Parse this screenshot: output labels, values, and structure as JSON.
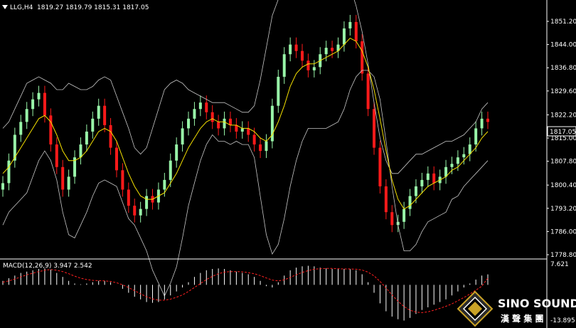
{
  "header": {
    "symbol": "LLG,H4",
    "ohlc": "1819.27 1819.79 1815.31 1817.05"
  },
  "price_axis": {
    "ticks": [
      "1851.20",
      "1844.00",
      "1836.80",
      "1829.60",
      "1822.20",
      "1815.00",
      "1807.80",
      "1800.40",
      "1793.20",
      "1786.00",
      "1778.80"
    ],
    "current_price": "1817.05"
  },
  "macd_panel": {
    "label": "MACD(12,26,9) 3.947 2.542",
    "top_label": "7.621",
    "bottom_label": "-13.895"
  },
  "logo": {
    "name": "SINO SOUND",
    "chinese": "漢 聲 集 團"
  },
  "colors": {
    "background": "#000000",
    "bull": "#98f5a8",
    "bear": "#ff1a1a",
    "ma": "#f5e100",
    "bands": "#c8c8c8",
    "macd_hist": "#ffffff",
    "macd_signal": "#ff2020"
  },
  "chart_data": [
    {
      "type": "line",
      "title": "LLG,H4",
      "description_series": [
        "close",
        "moving average",
        "bollinger upper",
        "bollinger lower"
      ],
      "ylim": [
        1778.8,
        1851.2
      ],
      "series": [
        {
          "name": "close",
          "values": [
            1801,
            1808,
            1816,
            1820,
            1824,
            1827,
            1829,
            1822,
            1813,
            1806,
            1799,
            1803,
            1809,
            1813,
            1817,
            1821,
            1825,
            1819,
            1812,
            1805,
            1799,
            1794,
            1791,
            1793,
            1797,
            1795,
            1799,
            1802,
            1808,
            1813,
            1818,
            1821,
            1824,
            1826,
            1823,
            1820,
            1818,
            1821,
            1819,
            1817,
            1818,
            1816,
            1813,
            1811,
            1814,
            1825,
            1834,
            1841,
            1844,
            1842,
            1839,
            1836,
            1837,
            1841,
            1843,
            1842,
            1844,
            1849,
            1851,
            1845,
            1835,
            1824,
            1812,
            1800,
            1792,
            1788,
            1789,
            1793,
            1797,
            1800,
            1802,
            1804,
            1801,
            1803,
            1806,
            1807,
            1809,
            1810,
            1813,
            1818,
            1821,
            1820
          ]
        },
        {
          "name": "moving average",
          "values": [
            1804,
            1806,
            1809,
            1812,
            1815,
            1818,
            1821,
            1822,
            1820,
            1816,
            1811,
            1808,
            1808,
            1809,
            1811,
            1814,
            1817,
            1818,
            1817,
            1814,
            1809,
            1804,
            1800,
            1797,
            1796,
            1796,
            1797,
            1798,
            1801,
            1804,
            1808,
            1812,
            1815,
            1818,
            1820,
            1821,
            1820,
            1820,
            1819,
            1819,
            1818,
            1818,
            1817,
            1815,
            1814,
            1816,
            1820,
            1825,
            1831,
            1835,
            1837,
            1838,
            1838,
            1839,
            1840,
            1841,
            1842,
            1844,
            1846,
            1845,
            1842,
            1837,
            1830,
            1821,
            1811,
            1802,
            1796,
            1793,
            1794,
            1796,
            1798,
            1800,
            1801,
            1802,
            1803,
            1805,
            1806,
            1808,
            1810,
            1812,
            1815,
            1817
          ]
        },
        {
          "name": "bollinger upper",
          "values": [
            1818,
            1820,
            1824,
            1828,
            1832,
            1833,
            1834,
            1833,
            1832,
            1830,
            1830,
            1832,
            1831,
            1830,
            1830,
            1831,
            1833,
            1834,
            1833,
            1828,
            1823,
            1818,
            1812,
            1810,
            1812,
            1818,
            1824,
            1830,
            1832,
            1833,
            1832,
            1830,
            1829,
            1828,
            1827,
            1826,
            1826,
            1826,
            1825,
            1824,
            1823,
            1823,
            1825,
            1833,
            1843,
            1853,
            1858,
            1860,
            1862,
            1862,
            1860,
            1858,
            1858,
            1860,
            1862,
            1863,
            1864,
            1864,
            1862,
            1856,
            1848,
            1838,
            1826,
            1815,
            1808,
            1804,
            1804,
            1806,
            1808,
            1810,
            1810,
            1811,
            1812,
            1813,
            1814,
            1814,
            1815,
            1816,
            1818,
            1820,
            1824,
            1826
          ]
        },
        {
          "name": "bollinger lower",
          "values": [
            1788,
            1792,
            1794,
            1796,
            1798,
            1803,
            1808,
            1811,
            1808,
            1802,
            1792,
            1785,
            1784,
            1788,
            1792,
            1797,
            1801,
            1802,
            1801,
            1800,
            1795,
            1790,
            1788,
            1784,
            1780,
            1774,
            1770,
            1766,
            1770,
            1775,
            1784,
            1794,
            1801,
            1808,
            1813,
            1816,
            1814,
            1814,
            1813,
            1814,
            1813,
            1813,
            1809,
            1797,
            1785,
            1779,
            1782,
            1790,
            1800,
            1808,
            1814,
            1818,
            1818,
            1818,
            1818,
            1819,
            1820,
            1824,
            1830,
            1834,
            1836,
            1836,
            1834,
            1827,
            1814,
            1800,
            1788,
            1780,
            1780,
            1782,
            1786,
            1789,
            1790,
            1791,
            1792,
            1796,
            1797,
            1800,
            1802,
            1804,
            1806,
            1808
          ]
        }
      ]
    },
    {
      "type": "bar",
      "title": "MACD(12,26,9)",
      "ylim": [
        -13.895,
        7.621
      ],
      "series": [
        {
          "name": "histogram",
          "values": [
            1.5,
            2.5,
            3.5,
            4.5,
            5.0,
            5.5,
            6.0,
            6.2,
            5.8,
            4.5,
            3.0,
            1.5,
            0.5,
            0.2,
            0.5,
            1.0,
            1.5,
            1.5,
            1.0,
            0.0,
            -1.5,
            -3.0,
            -4.5,
            -5.5,
            -6.5,
            -6.8,
            -6.5,
            -5.5,
            -4.0,
            -2.5,
            -1.0,
            1.0,
            3.0,
            4.5,
            5.5,
            6.0,
            6.2,
            6.0,
            5.5,
            5.0,
            4.5,
            4.0,
            3.0,
            1.5,
            -0.5,
            -1.0,
            1.0,
            3.5,
            5.5,
            6.5,
            7.0,
            7.2,
            7.0,
            6.5,
            6.2,
            6.0,
            6.0,
            6.0,
            6.0,
            5.5,
            4.0,
            1.0,
            -3.0,
            -7.0,
            -10.0,
            -12.0,
            -13.0,
            -13.5,
            -12.5,
            -11.0,
            -9.5,
            -8.5,
            -7.5,
            -6.5,
            -5.5,
            -4.0,
            -2.5,
            -1.0,
            0.5,
            2.0,
            3.5,
            3.947
          ]
        },
        {
          "name": "signal",
          "values": [
            1.0,
            1.5,
            2.2,
            3.0,
            3.8,
            4.4,
            5.0,
            5.5,
            5.8,
            5.5,
            5.0,
            4.2,
            3.3,
            2.5,
            2.0,
            1.7,
            1.6,
            1.5,
            1.3,
            0.8,
            0.0,
            -1.0,
            -2.2,
            -3.4,
            -4.5,
            -5.3,
            -5.8,
            -5.8,
            -5.4,
            -4.7,
            -3.8,
            -2.5,
            -1.0,
            0.5,
            2.0,
            3.2,
            4.2,
            4.8,
            5.0,
            5.0,
            4.9,
            4.6,
            4.2,
            3.5,
            2.6,
            1.8,
            1.5,
            1.9,
            2.8,
            3.8,
            4.7,
            5.4,
            5.9,
            6.1,
            6.2,
            6.2,
            6.1,
            6.0,
            6.0,
            5.9,
            5.6,
            4.8,
            3.4,
            1.3,
            -1.2,
            -3.8,
            -6.2,
            -8.2,
            -9.6,
            -10.3,
            -10.5,
            -10.2,
            -9.6,
            -8.9,
            -8.1,
            -7.2,
            -6.0,
            -4.8,
            -3.5,
            -2.0,
            -0.5,
            2.542
          ]
        }
      ]
    }
  ]
}
